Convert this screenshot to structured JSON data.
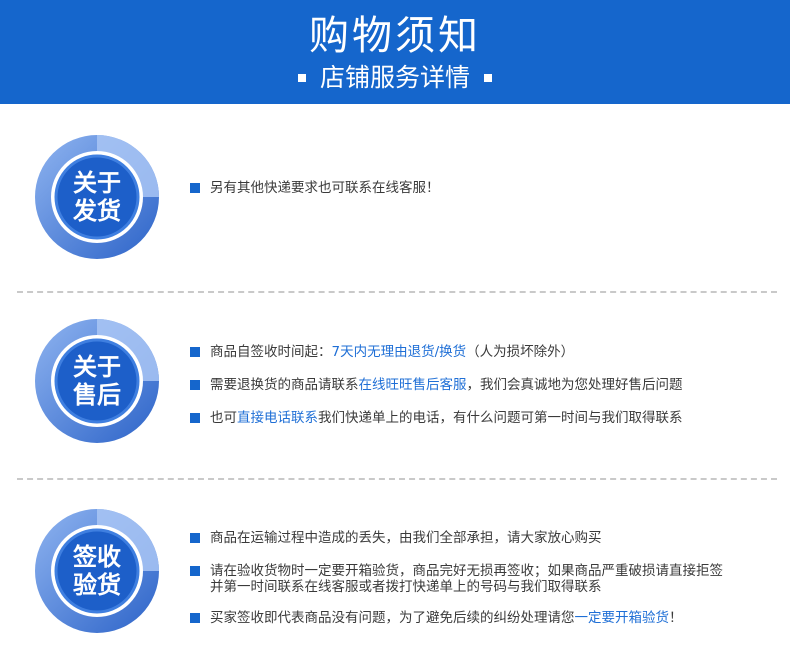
{
  "header": {
    "title": "购物须知",
    "subtitle": "店铺服务详情"
  },
  "colors": {
    "brand_blue": "#1566cc",
    "badge_outer": "#2f6fd6",
    "badge_inner": "#1a5ec9",
    "highlight": "#1f6fd6"
  },
  "sections": [
    {
      "badge_line1": "关于",
      "badge_line2": "发货",
      "items": [
        {
          "text": "另有其他快递要求也可联系在线客服！"
        }
      ]
    },
    {
      "badge_line1": "关于",
      "badge_line2": "售后",
      "items": [
        {
          "pre": "商品自签收时间起：",
          "hl": "7天内无理由退货/换货",
          "post": "（人为损坏除外）"
        },
        {
          "pre": "需要退换货的商品请联系",
          "hl": "在线旺旺售后客服",
          "post": "，我们会真诚地为您处理好售后问题"
        },
        {
          "pre": "也可",
          "hl": "直接电话联系",
          "post": "我们快递单上的电话，有什么问题可第一时间与我们取得联系"
        }
      ]
    },
    {
      "badge_line1": "签收",
      "badge_line2": "验货",
      "items": [
        {
          "text": "商品在运输过程中造成的丢失，由我们全部承担，请大家放心购买"
        },
        {
          "line1": "请在验收货物时一定要开箱验货，商品完好无损再签收；如果商品严重破损请直接拒签",
          "line2": "并第一时间联系在线客服或者拨打快递单上的号码与我们取得联系"
        },
        {
          "pre": "买家签收即代表商品没有问题，为了避免后续的纠纷处理请您",
          "hl": "一定要开箱验货",
          "post": "！"
        }
      ]
    }
  ]
}
